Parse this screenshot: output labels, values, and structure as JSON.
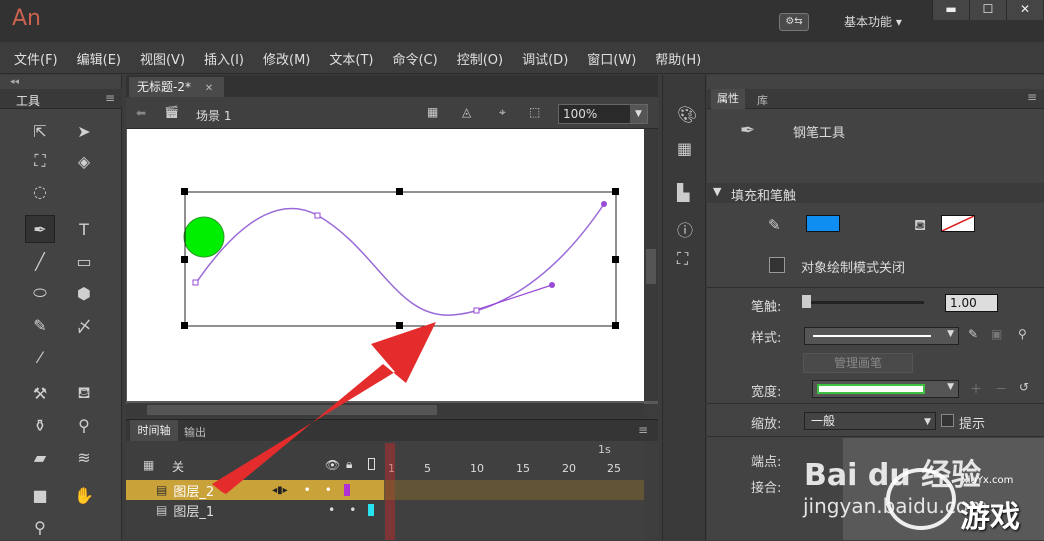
{
  "app": {
    "logo": "An",
    "sync_label": "⚙⇆",
    "workspace": "基本功能 ▾",
    "win_min": "▬",
    "win_max": "☐",
    "win_close": "✕"
  },
  "menu": [
    "文件(F)",
    "编辑(E)",
    "视图(V)",
    "插入(I)",
    "修改(M)",
    "文本(T)",
    "命令(C)",
    "控制(O)",
    "调试(D)",
    "窗口(W)",
    "帮助(H)"
  ],
  "tools_panel": {
    "title": "工具",
    "collapse": "◂◂"
  },
  "document": {
    "tab_title": "无标题-2*",
    "tab_close": "✕",
    "scene": "场景 1",
    "zoom": "100%"
  },
  "timeline": {
    "tabs": [
      "时间轴",
      "输出"
    ],
    "header_label": "关",
    "ruler": [
      "1",
      "5",
      "10",
      "15",
      "20",
      "25"
    ],
    "seconds_marker": "1s",
    "layers": [
      {
        "name": "图层_2",
        "selected": true,
        "color": "#b12fd6"
      },
      {
        "name": "图层_1",
        "selected": false,
        "color": "#27e4f0"
      }
    ]
  },
  "properties": {
    "tabs": [
      "属性",
      "库"
    ],
    "tool_name": "钢笔工具",
    "section": "填充和笔触",
    "fill_color": "#0d8ef0",
    "object_mode": "对象绘制模式关闭",
    "stroke_label": "笔触:",
    "stroke_value": "1.00",
    "style_label": "样式:",
    "manage_brush": "管理画笔",
    "width_label": "宽度:",
    "scale_label": "缩放:",
    "scale_value": "一般",
    "hint_label": "提示",
    "cap_label": "端点:",
    "join_label": "接合:"
  },
  "watermark": {
    "baidu": "Bai du 经验",
    "site": "jingyan.baidu.com",
    "brand": "游戏",
    "url": "xiaYx.com"
  }
}
